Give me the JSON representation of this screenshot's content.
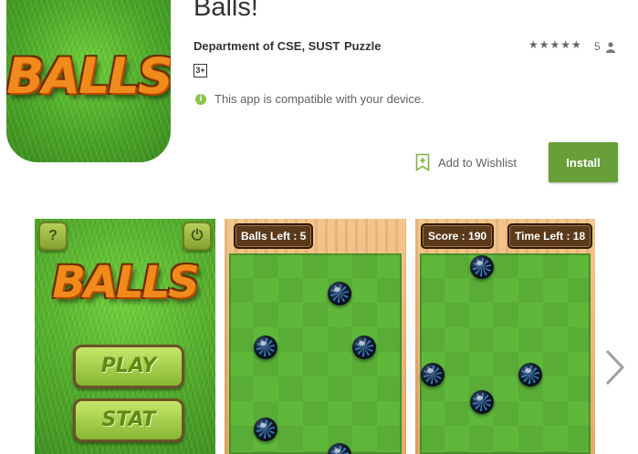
{
  "app": {
    "title": "Balls!",
    "developer": "Department of CSE, SUST",
    "category": "Puzzle",
    "rating_stars": "★★★★★",
    "rating_count": "5",
    "content_rating": "3+",
    "compat_text": "This app is compatible with your device.",
    "wishlist_label": "Add to Wishlist",
    "install_label": "Install",
    "icon_logo": "BALLS"
  },
  "screenshots": [
    {
      "logo": "BALLS",
      "help_glyph": "?",
      "power_glyph": "⏻",
      "buttons": [
        "PLAY",
        "STAT"
      ]
    },
    {
      "hud": [
        "Balls Left : 5"
      ]
    },
    {
      "hud": [
        "Score : 190",
        "Time Left : 18"
      ]
    }
  ],
  "colors": {
    "install": "#689f38",
    "compat_icon": "#8bc34a"
  },
  "icons": [
    "person-icon",
    "bookmark-plus-icon",
    "check-circle-icon",
    "chevron-right-icon"
  ]
}
